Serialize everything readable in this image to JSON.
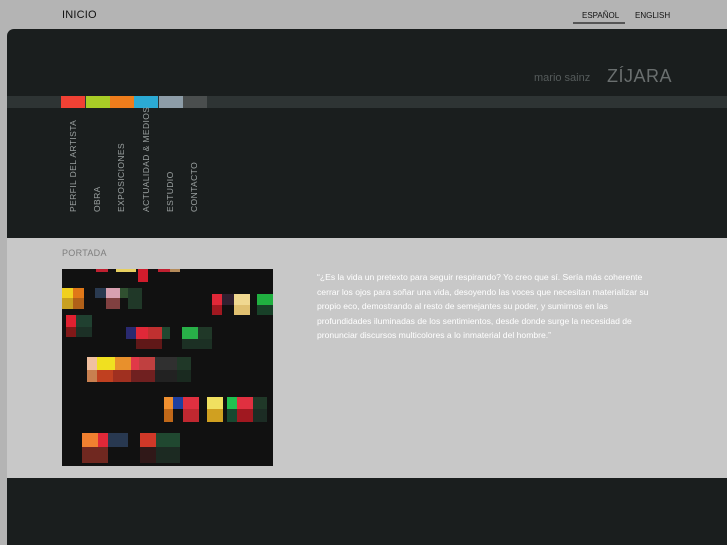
{
  "topbar": {
    "home_label": "INICIO",
    "lang_es": "ESPAÑOL",
    "lang_en": "ENGLISH"
  },
  "brand": {
    "first_name": "mario sainz",
    "last_name": "ZÍJARA"
  },
  "color_strip": [
    "#f04134",
    "#a8cc26",
    "#ee7d1c",
    "#2baad4",
    "#8d9da8",
    "#4a4e4e"
  ],
  "nav": [
    {
      "label": "PERFIL DEL  ARTISTA"
    },
    {
      "label": "OBRA"
    },
    {
      "label": "EXPOSICIONES"
    },
    {
      "label": "ACTUALIDAD & MEDIOS"
    },
    {
      "label": "ESTUDIO"
    },
    {
      "label": "CONTACTO"
    }
  ],
  "content": {
    "section_title": "PORTADA",
    "quote": "“¿Es la vida un pretexto para seguir respirando? Yo creo que sí. Sería más coherente cerrar los ojos para soñar una vida, desoyendo las voces que necesitan materializar su propio eco, demostrando al resto de semejantes su poder, y sumirnos en las profundidades iluminadas de los sentimientos, desde donde surge la necesidad de pronunciar discursos multicolores a lo inmaterial del hombre.”"
  },
  "artwork": {
    "icon": "abstract-color-blocks-painting"
  }
}
